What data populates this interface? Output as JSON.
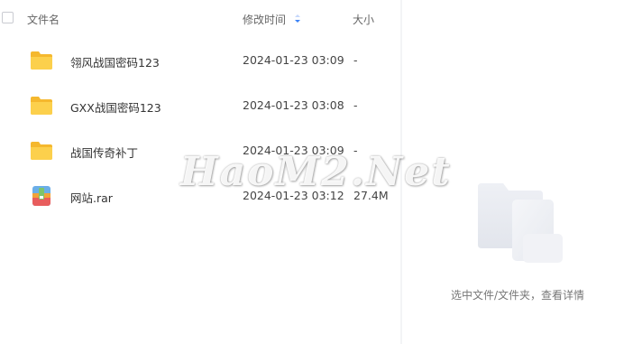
{
  "header": {
    "name_label": "文件名",
    "time_label": "修改时间",
    "size_label": "大小"
  },
  "files": [
    {
      "name": "翎风战国密码123",
      "modified": "2024-01-23 03:09",
      "size": "-",
      "icon": "folder-icon"
    },
    {
      "name": "GXX战国密码123",
      "modified": "2024-01-23 03:08",
      "size": "-",
      "icon": "folder-icon"
    },
    {
      "name": "战国传奇补丁",
      "modified": "2024-01-23 03:09",
      "size": "-",
      "icon": "folder-icon"
    },
    {
      "name": "网站.rar",
      "modified": "2024-01-23 03:12",
      "size": "27.4M",
      "icon": "archive-icon"
    }
  ],
  "watermark": "HaoM2.Net",
  "detail_panel": {
    "empty_text": "选中文件/文件夹，查看详情"
  },
  "colors": {
    "folder": "#f7c83d",
    "sort_arrow": "#3b82f6"
  }
}
